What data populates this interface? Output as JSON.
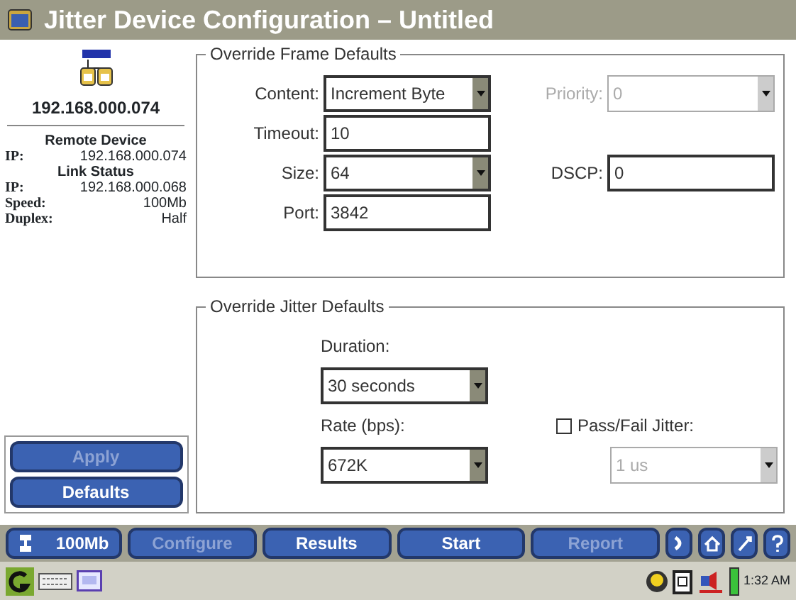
{
  "window": {
    "title": "Jitter Device Configuration – Untitled"
  },
  "sidebar": {
    "device_ip": "192.168.000.074",
    "sections": [
      {
        "heading": "Remote Device",
        "rows": [
          {
            "label": "IP:",
            "value": "192.168.000.074"
          }
        ]
      },
      {
        "heading": "Link Status",
        "rows": [
          {
            "label": "IP:",
            "value": "192.168.000.068"
          },
          {
            "label": "Speed:",
            "value": "100Mb"
          },
          {
            "label": "Duplex:",
            "value": "Half"
          }
        ]
      }
    ],
    "buttons": [
      {
        "label": "Apply",
        "disabled": true
      },
      {
        "label": "Defaults",
        "disabled": false
      }
    ]
  },
  "frame_defaults": {
    "title": "Override Frame Defaults",
    "rows": [
      [
        {
          "label": "Content:",
          "kind": "select",
          "value": "Increment Byte",
          "disabled": false
        },
        {
          "label": "Priority:",
          "kind": "select",
          "value": "0",
          "disabled": true
        }
      ],
      [
        {
          "label": "Timeout:",
          "kind": "text",
          "value": "10",
          "disabled": false
        }
      ],
      [
        {
          "label": "Size:",
          "kind": "select",
          "value": "64",
          "disabled": false
        },
        {
          "label": "DSCP:",
          "kind": "text",
          "value": "0",
          "disabled": false
        }
      ],
      [
        {
          "label": "Port:",
          "kind": "text",
          "value": "3842",
          "disabled": false
        }
      ]
    ]
  },
  "jitter_defaults": {
    "title": "Override Jitter Defaults",
    "duration": {
      "label": "Duration:",
      "value": "30 seconds"
    },
    "rate": {
      "label": "Rate (bps):",
      "value": "672K"
    },
    "pass_fail": {
      "label": "Pass/Fail Jitter:",
      "checked": false,
      "value": "1 us",
      "disabled": true
    }
  },
  "nav_buttons": [
    {
      "label": "100Mb",
      "disabled": false
    },
    {
      "label": "Configure",
      "disabled": true
    },
    {
      "label": "Results",
      "disabled": false
    },
    {
      "label": "Start",
      "disabled": false
    },
    {
      "label": "Report",
      "disabled": true
    }
  ],
  "status_bar": {
    "time": "1:32 AM"
  }
}
